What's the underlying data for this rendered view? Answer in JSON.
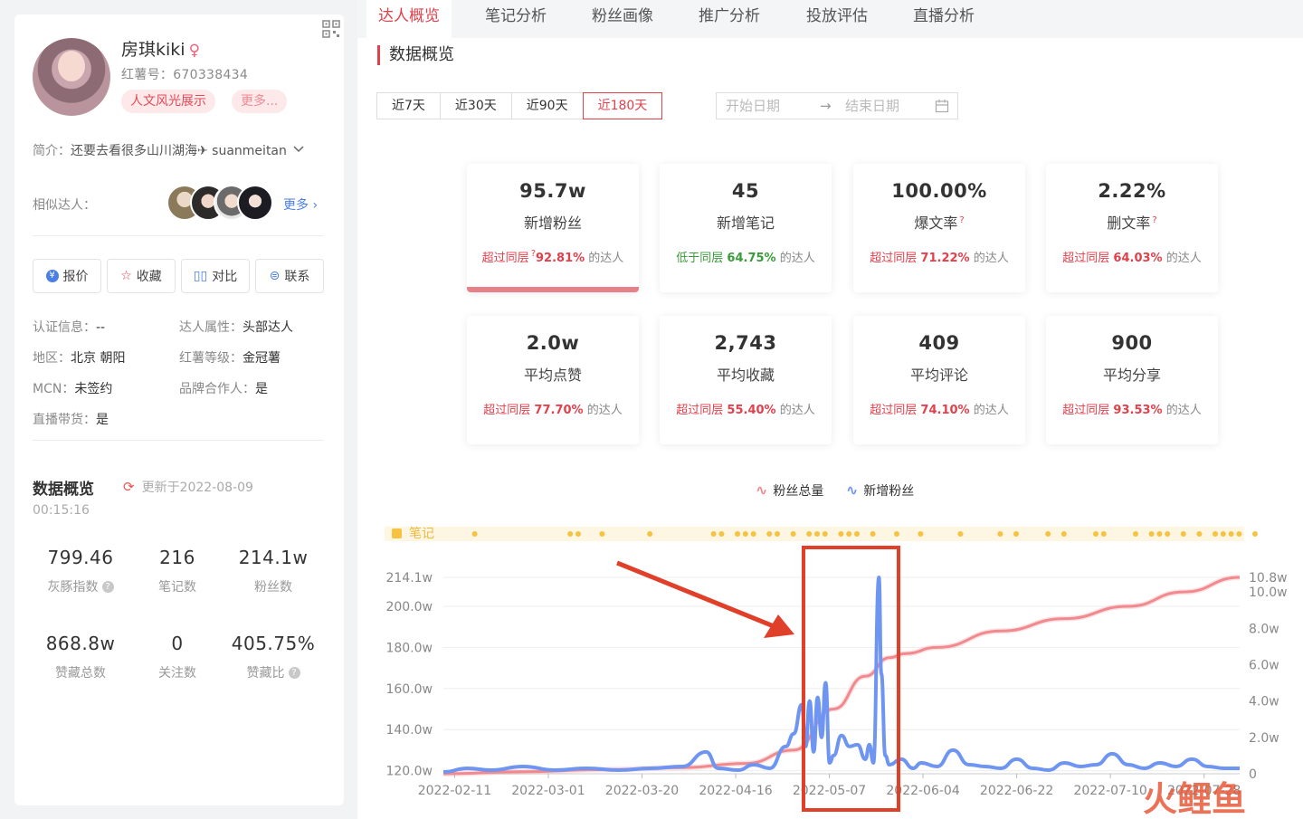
{
  "profile": {
    "name": "房琪kiki",
    "gender_symbol": "♀",
    "red_id": "红薯号：670338434",
    "tags": [
      "人文风光展示",
      "更多..."
    ],
    "bio_label": "简介：",
    "bio": "还要去看很多山川湖海✈ suanmeitan",
    "similar_label": "相似达人：",
    "similar_more": "更多",
    "actions": [
      {
        "label": "报价",
        "icon": "price-icon"
      },
      {
        "label": "收藏",
        "icon": "star-icon"
      },
      {
        "label": "对比",
        "icon": "compare-icon"
      },
      {
        "label": "联系",
        "icon": "chat-icon"
      }
    ],
    "info": [
      {
        "k": "认证信息：",
        "v": "--"
      },
      {
        "k": "达人属性：",
        "v": "头部达人"
      },
      {
        "k": "地区：",
        "v": "北京 朝阳"
      },
      {
        "k": "红薯等级：",
        "v": "金冠薯"
      },
      {
        "k": "MCN：",
        "v": "未签约"
      },
      {
        "k": "品牌合作人：",
        "v": "是"
      },
      {
        "k": "直播带货：",
        "v": "是"
      }
    ],
    "overview_title": "数据概览",
    "updated": "更新于2022-08-09",
    "updated_time": "00:15:16",
    "stats": [
      {
        "v": "799.46",
        "l": "灰豚指数"
      },
      {
        "v": "216",
        "l": "笔记数"
      },
      {
        "v": "214.1w",
        "l": "粉丝数"
      },
      {
        "v": "868.8w",
        "l": "赞藏总数"
      },
      {
        "v": "0",
        "l": "关注数"
      },
      {
        "v": "405.75%",
        "l": "赞藏比"
      }
    ]
  },
  "tabs": [
    "达人概览",
    "笔记分析",
    "粉丝画像",
    "推广分析",
    "投放评估",
    "直播分析"
  ],
  "section_title": "数据概览",
  "ranges": [
    "近7天",
    "近30天",
    "近90天",
    "近180天"
  ],
  "date_start_placeholder": "开始日期",
  "date_end_placeholder": "结束日期",
  "date_arrow": "→",
  "cards": [
    {
      "value": "95.7w",
      "label": "新增粉丝",
      "pre": "超过同层",
      "pct": "92.81%",
      "tail": "的达人"
    },
    {
      "value": "45",
      "label": "新增笔记",
      "pre": "低于同层",
      "pct": "64.75%",
      "tail": "的达人"
    },
    {
      "value": "100.00%",
      "label": "爆文率",
      "pre": "超过同层",
      "pct": "71.22%",
      "tail": "的达人"
    },
    {
      "value": "2.22%",
      "label": "删文率",
      "pre": "超过同层",
      "pct": "64.03%",
      "tail": "的达人"
    },
    {
      "value": "2.0w",
      "label": "平均点赞",
      "pre": "超过同层",
      "pct": "77.70%",
      "tail": "的达人"
    },
    {
      "value": "2,743",
      "label": "平均收藏",
      "pre": "超过同层",
      "pct": "55.40%",
      "tail": "的达人"
    },
    {
      "value": "409",
      "label": "平均评论",
      "pre": "超过同层",
      "pct": "74.10%",
      "tail": "的达人"
    },
    {
      "value": "900",
      "label": "平均分享",
      "pre": "超过同层",
      "pct": "93.53%",
      "tail": "的达人"
    }
  ],
  "colors": {
    "accent": "#e2404b",
    "total_line": "#f08a8f",
    "new_line": "#6f95f2",
    "note_dot": "#f5c242",
    "annotation": "#e0402a"
  },
  "watermark": "火鲤鱼",
  "chart_data": {
    "type": "line",
    "legend": [
      "粉丝总量",
      "新增粉丝"
    ],
    "notes_band_label": "笔记",
    "x_ticks": [
      "2022-02-11",
      "2022-03-01",
      "2022-03-20",
      "2022-04-16",
      "2022-05-07",
      "2022-06-04",
      "2022-06-22",
      "2022-07-10",
      "2022-07-28"
    ],
    "y_left_ticks": [
      "214.1w",
      "200.0w",
      "180.0w",
      "160.0w",
      "140.0w",
      "120.0w"
    ],
    "y_right_ticks": [
      "10.8w",
      "10.0w",
      "8.0w",
      "6.0w",
      "4.0w",
      "2.0w",
      "0"
    ],
    "y_left_range": [
      118.5,
      214.1
    ],
    "y_right_range": [
      0,
      10.8
    ],
    "series": [
      {
        "name": "粉丝总量",
        "axis": "left",
        "points": [
          [
            0,
            118.5
          ],
          [
            0.1,
            119.5
          ],
          [
            0.2,
            120.5
          ],
          [
            0.3,
            121.5
          ],
          [
            0.38,
            123.5
          ],
          [
            0.44,
            130
          ],
          [
            0.49,
            150
          ],
          [
            0.53,
            166
          ],
          [
            0.56,
            175
          ],
          [
            0.58,
            177
          ],
          [
            0.62,
            180
          ],
          [
            0.7,
            188
          ],
          [
            0.78,
            194
          ],
          [
            0.86,
            200
          ],
          [
            0.93,
            207
          ],
          [
            1,
            214.1
          ]
        ]
      },
      {
        "name": "新增粉丝",
        "axis": "right",
        "points": [
          [
            0,
            0.1
          ],
          [
            0.03,
            0.3
          ],
          [
            0.06,
            0.2
          ],
          [
            0.1,
            0.4
          ],
          [
            0.14,
            0.2
          ],
          [
            0.18,
            0.3
          ],
          [
            0.22,
            0.2
          ],
          [
            0.26,
            0.3
          ],
          [
            0.3,
            0.4
          ],
          [
            0.33,
            1.2
          ],
          [
            0.345,
            0.3
          ],
          [
            0.37,
            0.2
          ],
          [
            0.39,
            0.5
          ],
          [
            0.41,
            0.3
          ],
          [
            0.43,
            1.5
          ],
          [
            0.44,
            2.2
          ],
          [
            0.45,
            3.8
          ],
          [
            0.455,
            1.5
          ],
          [
            0.46,
            4.0
          ],
          [
            0.465,
            1.2
          ],
          [
            0.47,
            4.2
          ],
          [
            0.475,
            2.0
          ],
          [
            0.48,
            5.0
          ],
          [
            0.485,
            0.6
          ],
          [
            0.49,
            1.0
          ],
          [
            0.5,
            2.1
          ],
          [
            0.51,
            1.5
          ],
          [
            0.52,
            1.6
          ],
          [
            0.53,
            0.8
          ],
          [
            0.535,
            1.6
          ],
          [
            0.54,
            0.6
          ],
          [
            0.547,
            10.8
          ],
          [
            0.55,
            5.5
          ],
          [
            0.555,
            1.0
          ],
          [
            0.56,
            0.5
          ],
          [
            0.575,
            0.8
          ],
          [
            0.59,
            0.3
          ],
          [
            0.6,
            0.6
          ],
          [
            0.62,
            0.4
          ],
          [
            0.64,
            1.3
          ],
          [
            0.66,
            0.5
          ],
          [
            0.68,
            0.4
          ],
          [
            0.7,
            0.3
          ],
          [
            0.72,
            0.8
          ],
          [
            0.74,
            0.3
          ],
          [
            0.76,
            0.2
          ],
          [
            0.78,
            0.6
          ],
          [
            0.8,
            0.4
          ],
          [
            0.82,
            0.5
          ],
          [
            0.84,
            1.1
          ],
          [
            0.86,
            0.5
          ],
          [
            0.88,
            0.3
          ],
          [
            0.9,
            0.6
          ],
          [
            0.92,
            0.4
          ],
          [
            0.94,
            0.8
          ],
          [
            0.96,
            0.4
          ],
          [
            0.98,
            0.3
          ],
          [
            1,
            0.3
          ]
        ]
      }
    ],
    "note_dots": [
      0.02,
      0.14,
      0.15,
      0.18,
      0.24,
      0.32,
      0.33,
      0.35,
      0.36,
      0.37,
      0.39,
      0.4,
      0.42,
      0.44,
      0.45,
      0.46,
      0.48,
      0.49,
      0.5,
      0.52,
      0.55,
      0.58,
      0.63,
      0.68,
      0.7,
      0.74,
      0.76,
      0.8,
      0.81,
      0.85,
      0.87,
      0.88,
      0.89,
      0.91,
      0.93,
      0.95,
      0.96,
      0.97,
      0.98,
      1.0
    ]
  }
}
